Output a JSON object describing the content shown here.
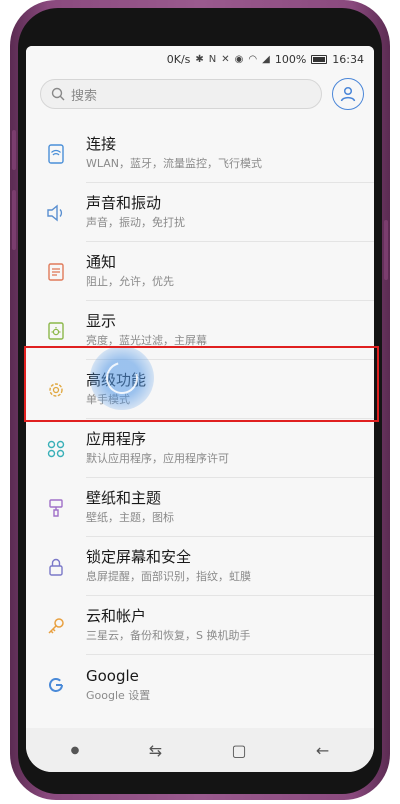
{
  "status_bar": {
    "network_speed": "0K/s",
    "battery_percent": "100%",
    "time": "16:34"
  },
  "search": {
    "placeholder": "搜索"
  },
  "settings": [
    {
      "title": "连接",
      "subtitle": "WLAN，蓝牙，流量监控，飞行模式",
      "icon": "wifi-doc-icon"
    },
    {
      "title": "声音和振动",
      "subtitle": "声音，振动，免打扰",
      "icon": "speaker-icon"
    },
    {
      "title": "通知",
      "subtitle": "阻止，允许，优先",
      "icon": "notification-icon"
    },
    {
      "title": "显示",
      "subtitle": "亮度，蓝光过滤，主屏幕",
      "icon": "display-icon"
    },
    {
      "title": "高级功能",
      "subtitle": "单手模式",
      "icon": "advanced-gear-icon"
    },
    {
      "title": "应用程序",
      "subtitle": "默认应用程序，应用程序许可",
      "icon": "apps-grid-icon"
    },
    {
      "title": "壁纸和主题",
      "subtitle": "壁纸，主题，图标",
      "icon": "brush-icon"
    },
    {
      "title": "锁定屏幕和安全",
      "subtitle": "息屏提醒，面部识别，指纹，虹膜",
      "icon": "lock-icon"
    },
    {
      "title": "云和帐户",
      "subtitle": "三星云，备份和恢复，S 换机助手",
      "icon": "key-icon"
    },
    {
      "title": "Google",
      "subtitle": "Google 设置",
      "icon": "google-icon"
    }
  ],
  "colors": {
    "highlight": "#e02020",
    "accent": "#4a86d8"
  }
}
